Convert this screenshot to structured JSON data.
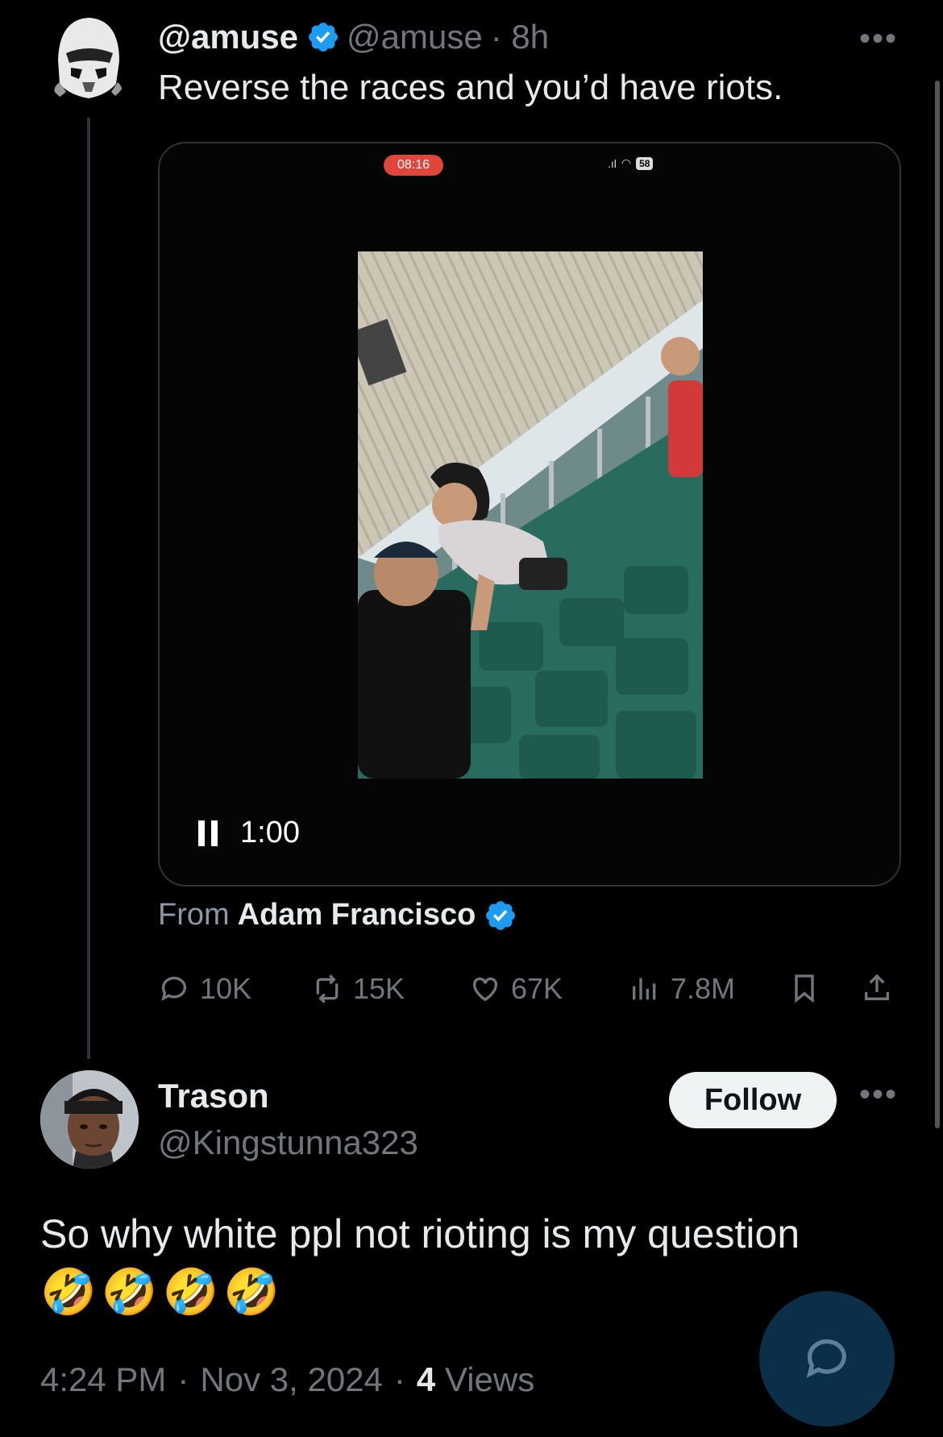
{
  "parent_tweet": {
    "display_name": "@amuse",
    "handle": "@amuse",
    "time": "· 8h",
    "text": "Reverse the races and you’d have riots.",
    "media": {
      "recording_time": "08:16",
      "battery": "58",
      "elapsed": "1:00"
    },
    "from_label": "From",
    "from_name": "Adam Francisco",
    "actions": {
      "replies": "10K",
      "reposts": "15K",
      "likes": "67K",
      "views": "7.8M"
    }
  },
  "reply": {
    "display_name": "Trason",
    "handle": "@Kingstunna323",
    "follow_label": "Follow",
    "text": "So why white ppl not rioting is my question",
    "emojis": [
      "🤣",
      "🤣",
      "🤣",
      "🤣"
    ],
    "time": "4:24 PM",
    "date": "Nov 3, 2024",
    "views_count": "4",
    "views_label": "Views"
  },
  "colors": {
    "background": "#000000",
    "verified": "#1d9bf0",
    "muted": "#71767b",
    "fab": "#0c2f49"
  },
  "icons": [
    "verified-badge-icon",
    "more-icon",
    "pause-icon",
    "reply-icon",
    "repost-icon",
    "like-icon",
    "views-icon",
    "bookmark-icon",
    "share-icon",
    "compose-reply-icon"
  ]
}
